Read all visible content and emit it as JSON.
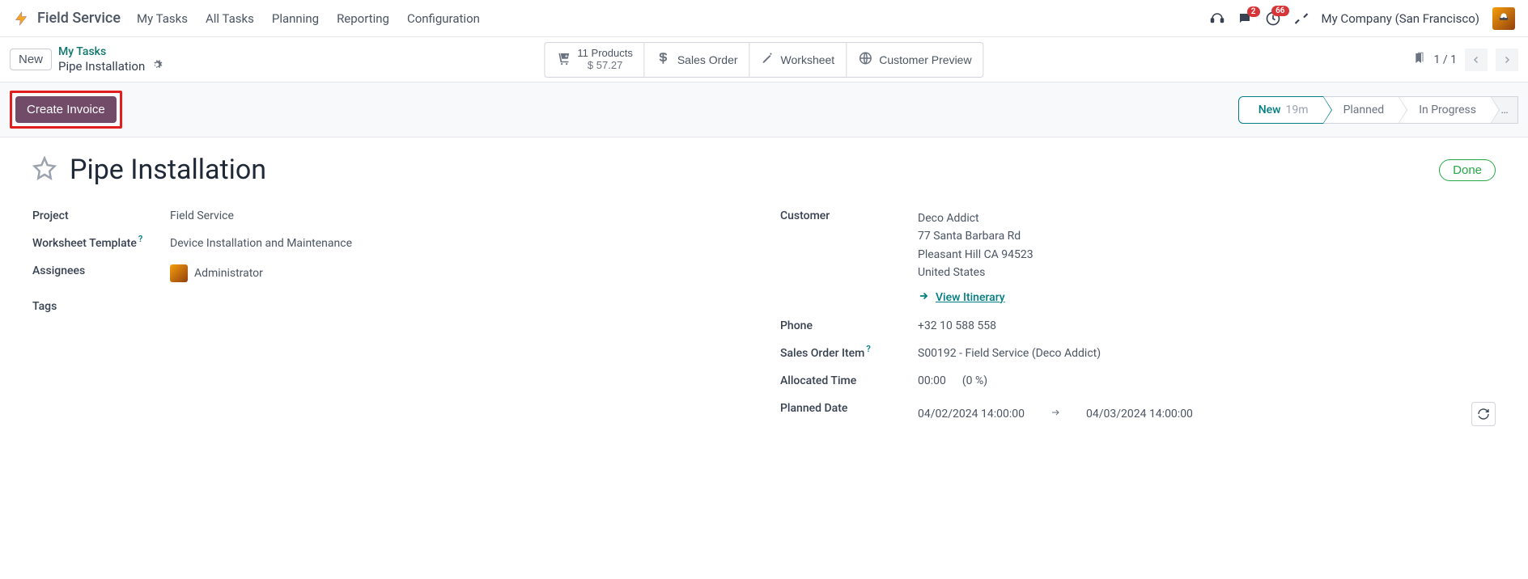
{
  "nav": {
    "app_name": "Field Service",
    "menu": [
      "My Tasks",
      "All Tasks",
      "Planning",
      "Reporting",
      "Configuration"
    ],
    "chat_badge": "2",
    "activity_badge": "66",
    "company": "My Company (San Francisco)"
  },
  "subheader": {
    "new_btn": "New",
    "breadcrumb_parent": "My Tasks",
    "breadcrumb_current": "Pipe Installation",
    "stat_products_line1": "11 Products",
    "stat_products_line2": "$ 57.27",
    "stat_sales_order": "Sales Order",
    "stat_worksheet": "Worksheet",
    "stat_customer_preview": "Customer Preview",
    "pager": "1 / 1"
  },
  "action": {
    "create_invoice": "Create Invoice",
    "statuses": [
      {
        "label": "New",
        "time": "19m",
        "active": true
      },
      {
        "label": "Planned",
        "active": false
      },
      {
        "label": "In Progress",
        "active": false
      }
    ],
    "more": "…"
  },
  "form": {
    "title": "Pipe Installation",
    "done_btn": "Done",
    "labels": {
      "project": "Project",
      "worksheet_template": "Worksheet Template",
      "assignees": "Assignees",
      "tags": "Tags",
      "customer": "Customer",
      "phone": "Phone",
      "sales_order_item": "Sales Order Item",
      "allocated_time": "Allocated Time",
      "planned_date": "Planned Date"
    },
    "values": {
      "project": "Field Service",
      "worksheet_template": "Device Installation and Maintenance",
      "assignee_name": "Administrator",
      "customer_name": "Deco Addict",
      "customer_street": "77 Santa Barbara Rd",
      "customer_city": "Pleasant Hill CA 94523",
      "customer_country": "United States",
      "view_itinerary": "View Itinerary",
      "phone": "+32 10 588 558",
      "sales_order_item": "S00192 - Field Service (Deco Addict)",
      "allocated_time_val": "00:00",
      "allocated_time_pct": "(0 %)",
      "planned_start": "04/02/2024 14:00:00",
      "planned_end": "04/03/2024 14:00:00"
    }
  }
}
